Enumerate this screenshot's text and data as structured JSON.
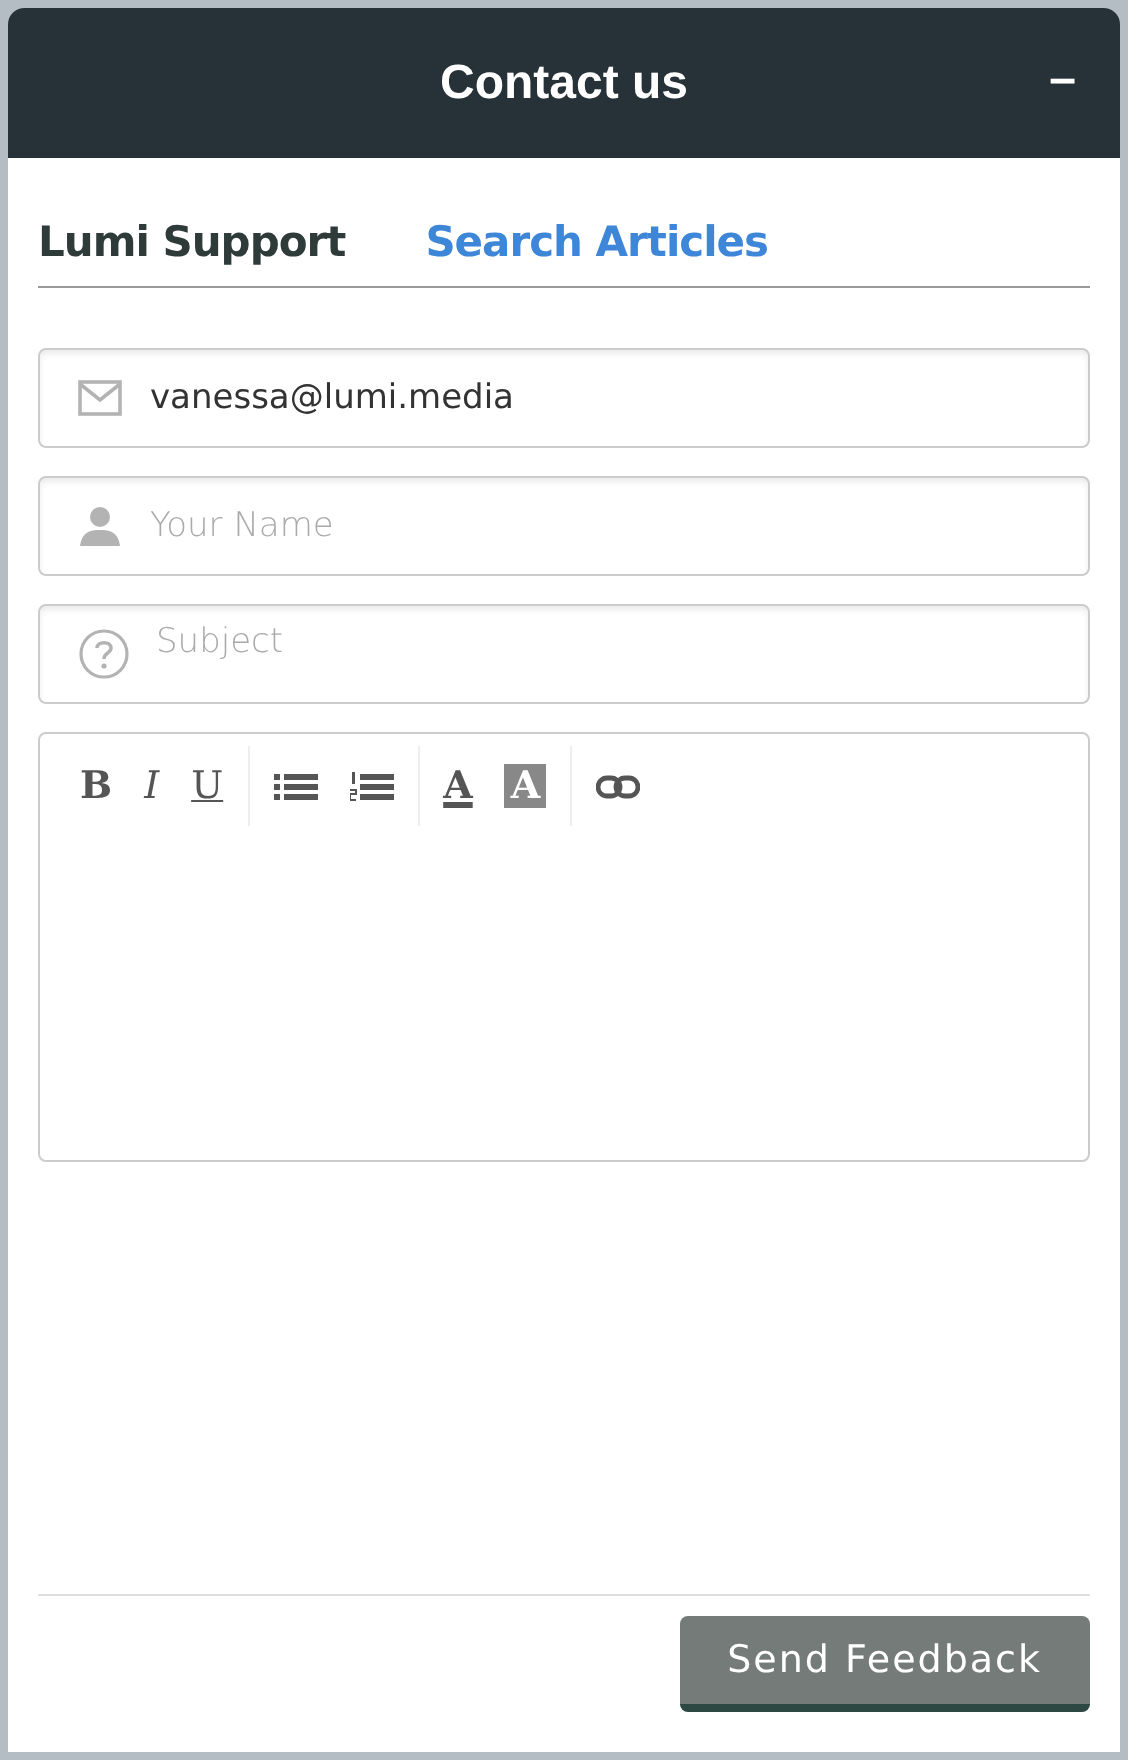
{
  "header": {
    "title": "Contact us",
    "minimize": "–"
  },
  "tabs": [
    {
      "label": "Lumi Support",
      "selected": true
    },
    {
      "label": "Search Articles",
      "selected": false
    }
  ],
  "fields": [
    {
      "kind": "email",
      "value": "vanessa@lumi.media"
    },
    {
      "kind": "person",
      "placeholder": "Your Name"
    },
    {
      "kind": "question",
      "placeholder": "Subject"
    }
  ],
  "editor": {
    "toolbar": [
      [
        {
          "kind": "bold",
          "label": "B"
        },
        {
          "kind": "italic",
          "label": "I"
        },
        {
          "kind": "underline",
          "label": "U"
        }
      ],
      [
        {
          "kind": "bullet-list"
        },
        {
          "kind": "number-list"
        }
      ],
      [
        {
          "kind": "text-color",
          "label": "A"
        },
        {
          "kind": "highlight",
          "label": "A"
        }
      ],
      [
        {
          "kind": "link"
        }
      ]
    ]
  },
  "submit": {
    "label": "Send Feedback"
  }
}
